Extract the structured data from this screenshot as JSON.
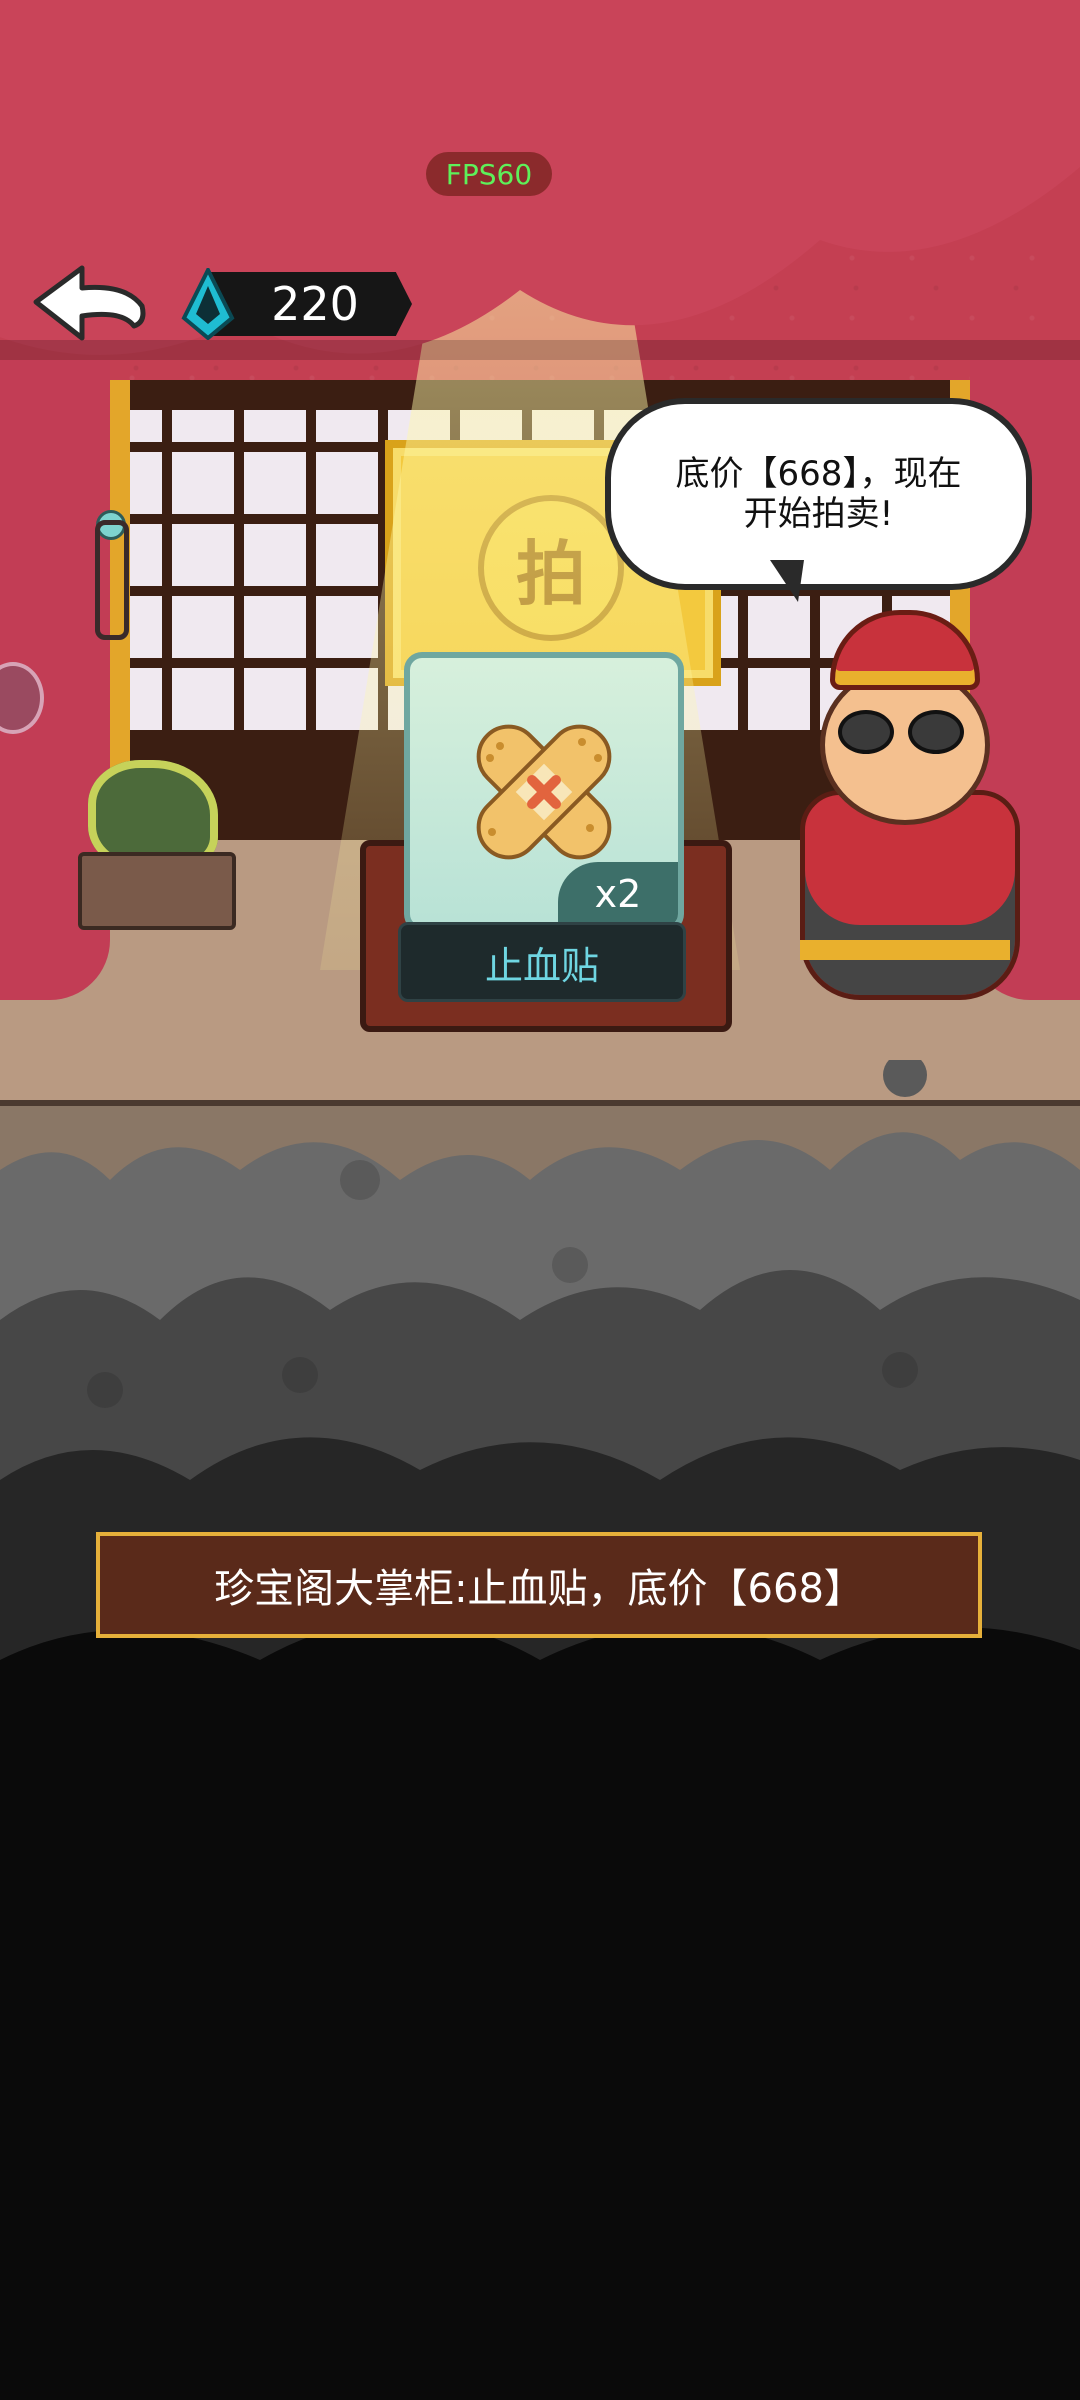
{
  "hud": {
    "fps_label": "FPS60",
    "gem_count": "220"
  },
  "auction": {
    "plaque_char": "拍",
    "item_name": "止血贴",
    "item_count": "x2",
    "speech_line1": "底价【668】，现在",
    "speech_line2": "开始拍卖!",
    "subtitle": "珍宝阁大掌柜:止血贴，底价【668】"
  },
  "icons": {
    "back": "back-arrow-icon",
    "gem": "gem-icon",
    "item": "bandage-icon"
  },
  "colors": {
    "curtain": "#c94459",
    "subtitle_bg": "#5a2a1a",
    "subtitle_border": "#e6b03a",
    "item_name_text": "#6fd6e2",
    "fps_text": "#5ef05a"
  }
}
